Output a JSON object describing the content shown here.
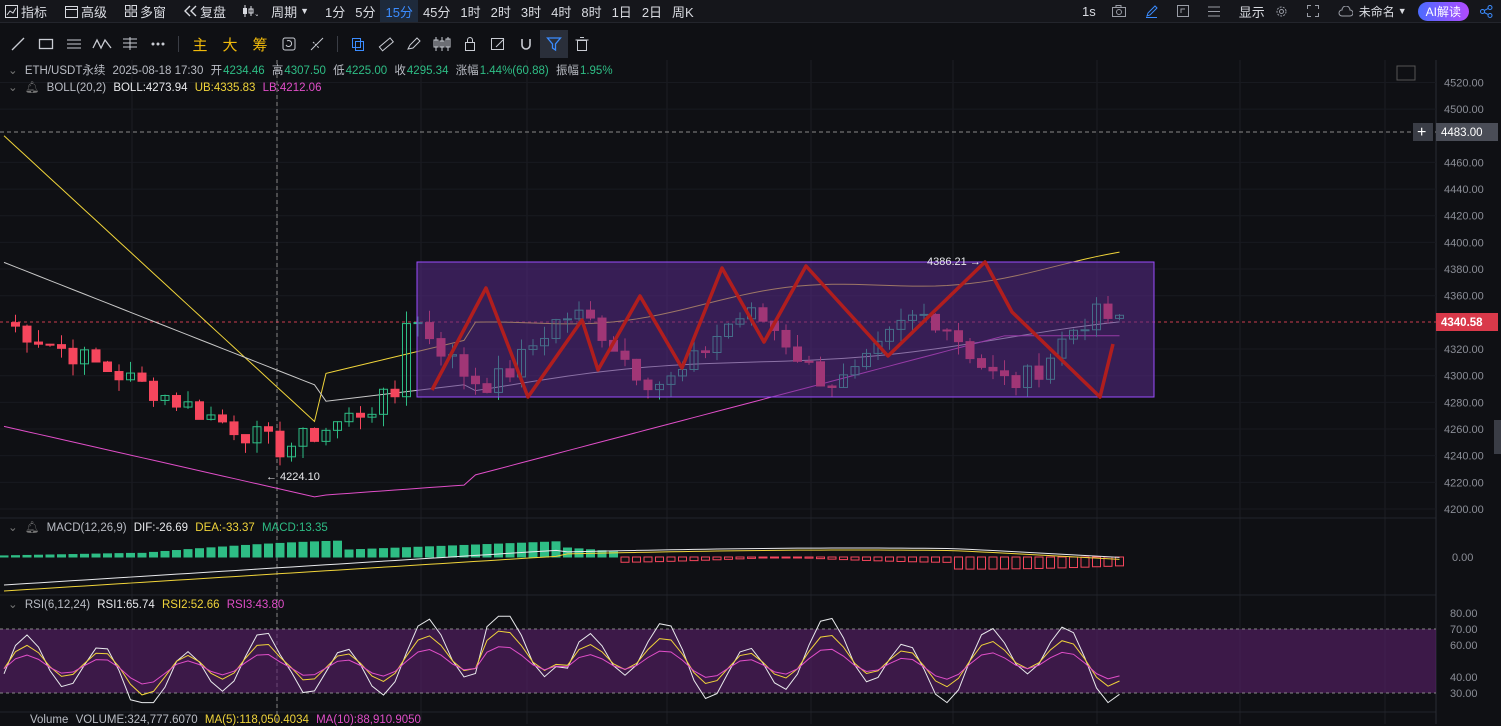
{
  "topbar": {
    "indicators": "指标",
    "advanced": "高级",
    "multi_window": "多窗",
    "replay": "复盘",
    "period": "周期",
    "intervals": [
      "1分",
      "5分",
      "15分",
      "45分",
      "1时",
      "2时",
      "3时",
      "4时",
      "8时",
      "1日",
      "2日",
      "周K"
    ],
    "active_interval": "15分",
    "right_interval": "1s",
    "display": "显示",
    "unnamed": "未命名",
    "ai_label": "AI解读"
  },
  "drawing_toolbar": {
    "main": "主",
    "big": "大",
    "chips": "筹"
  },
  "main_info": {
    "symbol": "ETH/USDT永续",
    "datetime": "2025-08-18 17:30",
    "open_label": "开",
    "open": "4234.46",
    "high_label": "高",
    "high": "4307.50",
    "low_label": "低",
    "low": "4225.00",
    "close_label": "收",
    "close": "4295.34",
    "change_label": "涨幅",
    "change": "1.44%(60.88)",
    "amp_label": "振幅",
    "amplitude": "1.95%"
  },
  "boll_info": {
    "name": "BOLL(20,2)",
    "boll": "BOLL:4273.94",
    "ub": "UB:4335.83",
    "lb": "LB:4212.06"
  },
  "macd_info": {
    "name": "MACD(12,26,9)",
    "dif": "DIF:-26.69",
    "dea": "DEA:-33.37",
    "macd": "MACD:13.35"
  },
  "rsi_info": {
    "name": "RSI(6,12,24)",
    "rsi1": "RSI1:65.74",
    "rsi2": "RSI2:52.66",
    "rsi3": "RSI3:43.80"
  },
  "volume_info": {
    "name": "Volume",
    "volume": "VOLUME:324,777.6070",
    "ma5": "MA(5):118,050.4034",
    "ma10": "MA(10):88,910.9050"
  },
  "price_axis": [
    "4520.00",
    "4500.00",
    "4460.00",
    "4440.00",
    "4420.00",
    "4400.00",
    "4380.00",
    "4360.00",
    "4320.00",
    "4300.00",
    "4280.00",
    "4260.00",
    "4240.00",
    "4220.00",
    "4200.00"
  ],
  "crosshair_price": "4483.00",
  "current_price": "4340.58",
  "macd_axis": [
    "0.00"
  ],
  "rsi_axis": [
    "80.00",
    "70.00",
    "60.00",
    "40.00",
    "30.00"
  ],
  "annotations": {
    "high_marker": "4386.21",
    "low_marker": "4224.10"
  },
  "colors": {
    "up": "#2ebd85",
    "down": "#f6465d",
    "boll_mid": "#c8c8c8",
    "boll_upper": "#f0d43a",
    "boll_lower": "#e04ec8",
    "box_fill": "#5a2a8a",
    "zigzag": "#b01e1e",
    "current_price_bg": "#d9394a"
  }
}
